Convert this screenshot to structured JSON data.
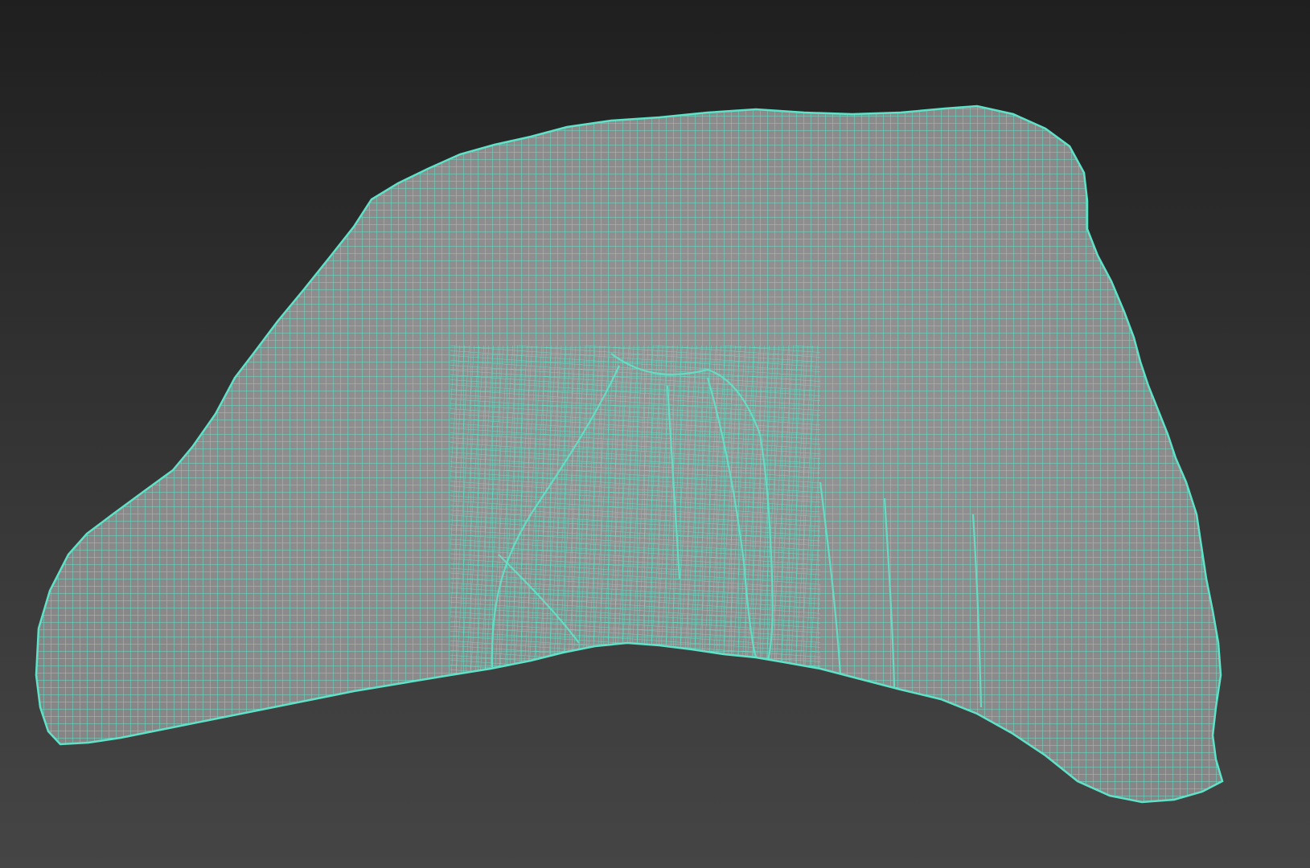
{
  "viewport": {
    "background_top": "#1f1f1f",
    "background_bottom": "#454545",
    "render_mode": "wireframe-on-shaded"
  },
  "mesh": {
    "shading_color": "#8c8c8c",
    "wire_color": "#5fe3c8",
    "topology": "quad-grid"
  }
}
